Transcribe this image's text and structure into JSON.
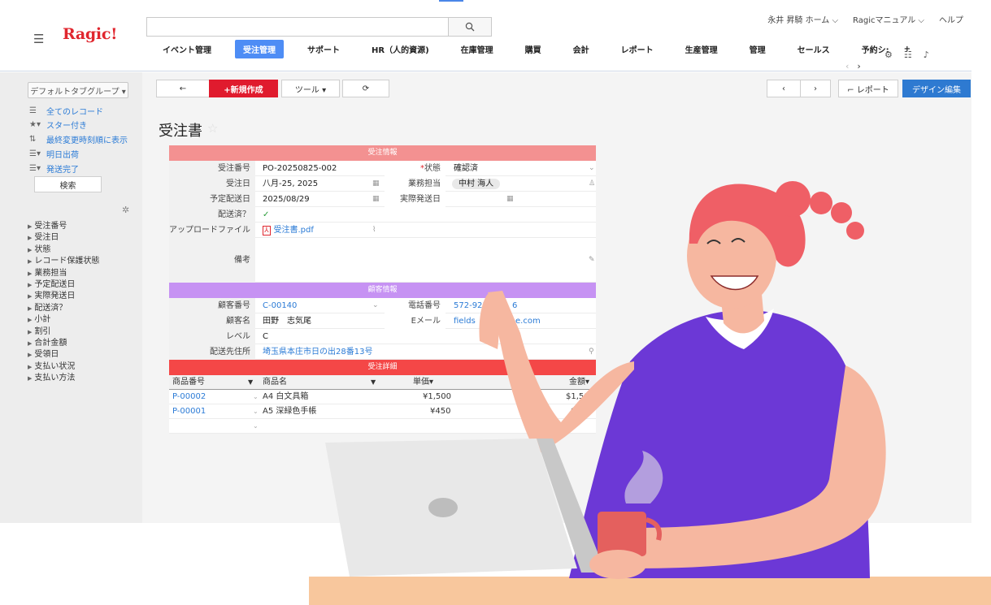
{
  "app": {
    "logo": "Ragic!",
    "menu_icon": "hamburger-icon"
  },
  "search": {
    "placeholder": "",
    "value": ""
  },
  "user_links": [
    "永井 昇騎 ホーム ⌵",
    "Ragicマニュアル ⌵",
    "ヘルプ"
  ],
  "main_tabs": [
    {
      "label": "イベント管理",
      "active": false
    },
    {
      "label": "受注管理",
      "active": true
    },
    {
      "label": "サポート",
      "active": false
    },
    {
      "label": "HR（人的資源)",
      "active": false
    },
    {
      "label": "在庫管理",
      "active": false
    },
    {
      "label": "購買",
      "active": false
    },
    {
      "label": "会計",
      "active": false
    },
    {
      "label": "レポート",
      "active": false
    },
    {
      "label": "生産管理",
      "active": false
    },
    {
      "label": "管理",
      "active": false
    },
    {
      "label": "セールス",
      "active": false
    },
    {
      "label": "予約シ:",
      "active": false
    }
  ],
  "tab_add": "+",
  "tab_scroll": {
    "prev": "‹",
    "next": "›"
  },
  "sidebar": {
    "tab_group": "デフォルトタブグループ ▾",
    "views": [
      {
        "icon": "☰",
        "label": "全てのレコード"
      },
      {
        "icon": "★▾",
        "label": "スター付き"
      },
      {
        "icon": "⇅",
        "label": "最終変更時刻順に表示"
      },
      {
        "icon": "☰▾",
        "label": "明日出荷"
      },
      {
        "icon": "☰▾",
        "label": "発送完了"
      }
    ],
    "search_button": "検索",
    "fields": [
      "受注番号",
      "受注日",
      "状態",
      "レコード保護状態",
      "業務担当",
      "予定配送日",
      "実際発送日",
      "配送済？",
      "小計",
      "割引",
      "合計金額",
      "受領日",
      "支払い状況",
      "支払い方法"
    ]
  },
  "toolbar": {
    "back": "←",
    "new": "+新規作成",
    "tools": "ツール ▾",
    "refresh": "⟳",
    "prev": "‹",
    "next": "›",
    "report": "⌐ レポート",
    "design": "デザイン編集"
  },
  "form": {
    "title": "受注書",
    "section_order": "受注情報",
    "order_number_label": "受注番号",
    "order_number": "PO-20250825-002",
    "status_label": "*状態",
    "status": "確認済",
    "order_date_label": "受注日",
    "order_date": "八月-25, 2025",
    "assignee_label": "業務担当",
    "assignee": "中村 海人",
    "planned_ship_label": "予定配送日",
    "planned_ship": "2025/08/29",
    "actual_ship_label": "実際発送日",
    "actual_ship": "",
    "delivered_label": "配送済？",
    "delivered": "✓",
    "upload_label": "アップロードファイル",
    "upload_file": "受注書.pdf",
    "notes_label": "備考",
    "notes": "",
    "section_customer": "顧客情報",
    "customer_id_label": "顧客番号",
    "customer_id": "C-00140",
    "phone_label": "電話番号",
    "phone": "572-923-1",
    "phone_tail": "6",
    "customer_name_label": "顧客名",
    "customer_name": "田野　志気尾",
    "email_label": "Eメール",
    "email": "fields",
    "email_tail": "e.com",
    "level_label": "レベル",
    "level": "C",
    "address_label": "配送先住所",
    "address": "埼玉県本庄市日の出28番13号",
    "section_detail": "受注詳細",
    "detail_columns": [
      "商品番号",
      "商品名",
      "単価▾",
      "金額▾"
    ],
    "detail_rows": [
      {
        "code": "P-00002",
        "name": "A4 白文具箱",
        "price": "¥1,500",
        "amount": "$1,500"
      },
      {
        "code": "P-00001",
        "name": "A5 深緑色手帳",
        "price": "¥450",
        "amount": "$900"
      }
    ]
  },
  "colors": {
    "brand_red": "#e0262e",
    "active_tab": "#4e8df5",
    "section_order": "#f39191",
    "section_customer": "#c692f3",
    "section_detail": "#f44747",
    "link": "#2b7bd6",
    "design_button": "#2e7ad1"
  }
}
